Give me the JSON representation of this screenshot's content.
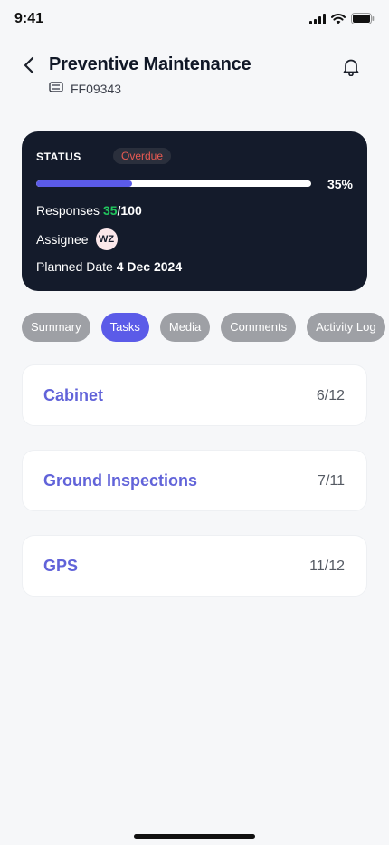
{
  "status_bar": {
    "time": "9:41"
  },
  "header": {
    "title": "Preventive Maintenance",
    "ticket_id": "FF09343"
  },
  "status_card": {
    "label": "STATUS",
    "badge": "Overdue",
    "progress_percent_value": 35,
    "progress_percent": "35%",
    "responses_label": "Responses",
    "responses_done": "35",
    "responses_total": "/100",
    "assignee_label": "Assignee",
    "assignee_initials": "WZ",
    "planned_label": "Planned Date",
    "planned_date": "4 Dec 2024"
  },
  "tabs": [
    {
      "label": "Summary",
      "active": false
    },
    {
      "label": "Tasks",
      "active": true
    },
    {
      "label": "Media",
      "active": false
    },
    {
      "label": "Comments",
      "active": false
    },
    {
      "label": "Activity Log",
      "active": false
    }
  ],
  "tasks": [
    {
      "name": "Cabinet",
      "count": "6/12"
    },
    {
      "name": "Ground Inspections",
      "count": "7/11"
    },
    {
      "name": "GPS",
      "count": "11/12"
    }
  ],
  "colors": {
    "accent": "#5b5be8",
    "card_bg": "#141b2b",
    "overdue": "#e85a52",
    "success": "#22c55e"
  }
}
